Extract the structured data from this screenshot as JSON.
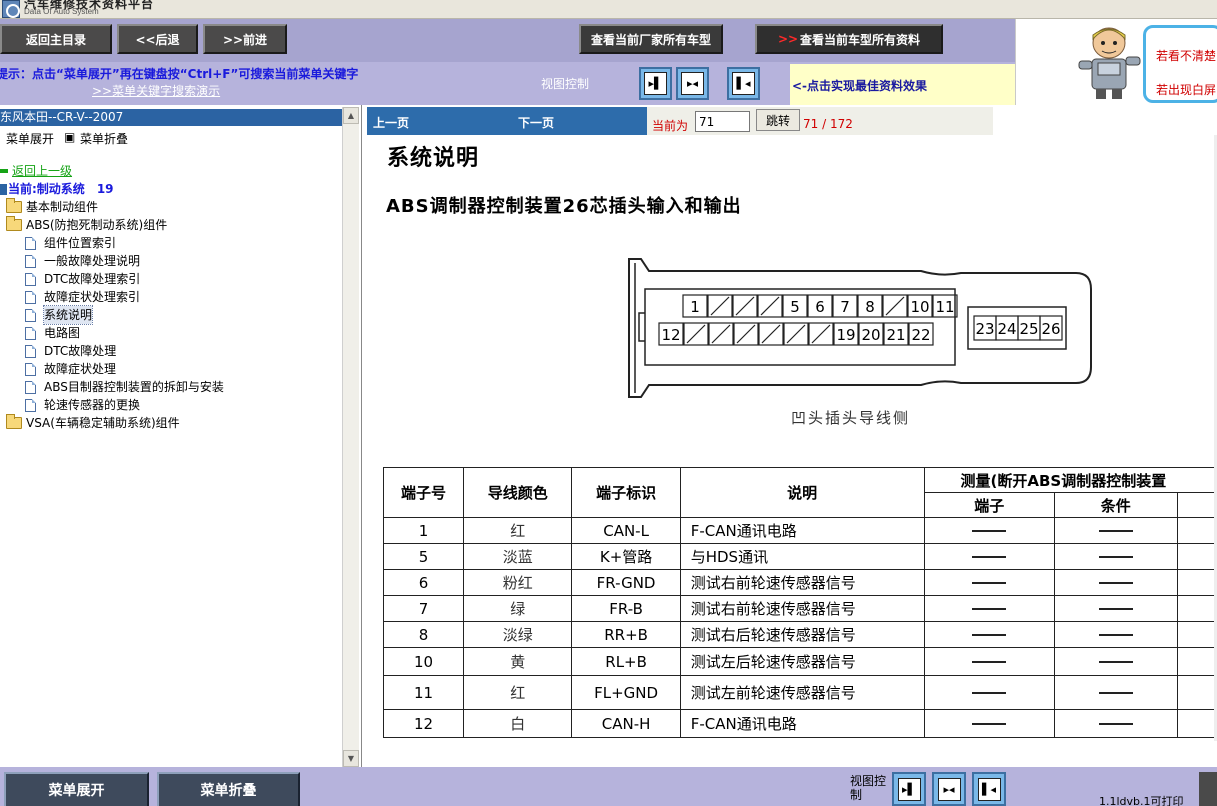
{
  "app": {
    "title_cn": "汽车维修技术资料平台",
    "subtitle_en": "Data Of Auto System"
  },
  "nav": {
    "home": "返回主目录",
    "back": "<<后退",
    "forward": ">>前进",
    "all_vendor_models": "查看当前厂家所有车型",
    "all_model_docs_arrow": ">>",
    "all_model_docs": "查看当前车型所有资料"
  },
  "info": {
    "hint": "提示：点击“菜单展开”再在键盘按“Ctrl+F”可搜索当前菜单关键字",
    "demo_link": ">>菜单关键字搜索演示",
    "view_control": "视图控制",
    "tip": "<-点击实现最佳资料效果"
  },
  "mascot": {
    "line1": "若看不清楚",
    "line2": "若出现白屏"
  },
  "sidebar": {
    "header": "东风本田--CR-V--2007",
    "expand": "菜单展开",
    "collapse": "菜单折叠",
    "back_up": "返回上一级",
    "current": "当前:制动系统",
    "current_count": "19",
    "items": [
      {
        "label": "基本制动组件",
        "type": "folder",
        "indent": 0
      },
      {
        "label": "ABS(防抱死制动系统)组件",
        "type": "folder-open",
        "indent": 0
      },
      {
        "label": "组件位置索引",
        "type": "doc",
        "indent": 1
      },
      {
        "label": "一般故障处理说明",
        "type": "doc",
        "indent": 1
      },
      {
        "label": "DTC故障处理索引",
        "type": "doc",
        "indent": 1
      },
      {
        "label": "故障症状处理索引",
        "type": "doc",
        "indent": 1
      },
      {
        "label": "系统说明",
        "type": "doc",
        "indent": 1,
        "selected": true
      },
      {
        "label": "电路图",
        "type": "doc",
        "indent": 1
      },
      {
        "label": "DTC故障处理",
        "type": "doc",
        "indent": 1
      },
      {
        "label": "故障症状处理",
        "type": "doc",
        "indent": 1
      },
      {
        "label": "ABS目制器控制装置的拆卸与安装",
        "type": "doc",
        "indent": 1
      },
      {
        "label": "轮速传感器的更换",
        "type": "doc",
        "indent": 1
      },
      {
        "label": "VSA(车辆稳定辅助系统)组件",
        "type": "folder",
        "indent": 0
      }
    ]
  },
  "content": {
    "prev": "上一页",
    "next": "下一页",
    "current_label": "当前为",
    "page_value": "71",
    "jump": "跳转",
    "page_count": "71 / 172",
    "doc_title": "系统说明",
    "doc_subtitle": "ABS调制器控制装置26芯插头输入和输出",
    "caption": "凹头插头导线侧",
    "connector_pins_top": [
      "1",
      "5",
      "6",
      "7",
      "8",
      "10",
      "11"
    ],
    "connector_pins_bottom": [
      "12",
      "19",
      "20",
      "21",
      "22"
    ],
    "connector_pins_right": [
      "23",
      "24",
      "25",
      "26"
    ],
    "table": {
      "headers": [
        "端子号",
        "导线颜色",
        "端子标识",
        "说明"
      ],
      "measure_header": "测量(断开ABS调制器控制装置",
      "measure_sub": [
        "端子",
        "条件"
      ],
      "rows": [
        {
          "pin": "1",
          "color": "红",
          "id": "CAN-L",
          "desc": "F-CAN通讯电路"
        },
        {
          "pin": "5",
          "color": "淡蓝",
          "id": "K+管路",
          "desc": "与HDS通讯"
        },
        {
          "pin": "6",
          "color": "粉红",
          "id": "FR-GND",
          "desc": "测试右前轮速传感器信号"
        },
        {
          "pin": "7",
          "color": "绿",
          "id": "FR-B",
          "desc": "测试右前轮速传感器信号"
        },
        {
          "pin": "8",
          "color": "淡绿",
          "id": "RR+B",
          "desc": "测试右后轮速传感器信号"
        },
        {
          "pin": "10",
          "color": "黄",
          "id": "RL+B",
          "desc": "测试左后轮速传感器信号"
        },
        {
          "pin": "11",
          "color": "红",
          "id": "FL+GND",
          "desc": "测试左前轮速传感器信号"
        },
        {
          "pin": "12",
          "color": "白",
          "id": "CAN-H",
          "desc": "F-CAN通讯电路"
        }
      ]
    }
  },
  "bottom": {
    "expand": "菜单展开",
    "collapse": "菜单折叠",
    "view_control": "视图控制",
    "status": "1.1ldvb.1可打印"
  },
  "colors": {
    "nav_bg": "#a6a4cf",
    "info_bg": "#b6b3dc",
    "sidebar_header": "#2b63a3",
    "toolbar_blue": "#2d6cab",
    "hint_text": "#1a1adc",
    "page_red": "#d00000"
  }
}
